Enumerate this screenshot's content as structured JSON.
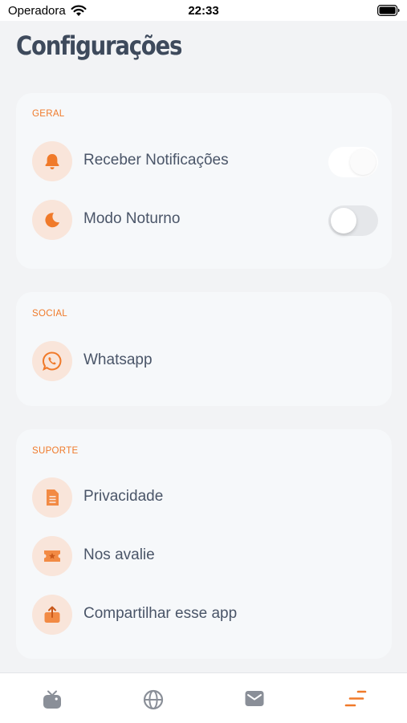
{
  "status_bar": {
    "carrier": "Operadora",
    "time": "22:33"
  },
  "title": "Configurações",
  "colors": {
    "accent": "#f07a2a",
    "icon_bg": "#f9e5da",
    "text": "#4a5568",
    "title": "#3e4a5c",
    "card": "#f6f8fa",
    "page_bg": "#f2f3f5",
    "tab_inactive": "#8a8f98"
  },
  "sections": [
    {
      "label": "GERAL",
      "items": [
        {
          "label": "Receber Notificações",
          "icon": "bell-icon",
          "toggle": true,
          "toggle_on": true
        },
        {
          "label": "Modo Noturno",
          "icon": "moon-icon",
          "toggle": true,
          "toggle_on": false
        }
      ]
    },
    {
      "label": "SOCIAL",
      "items": [
        {
          "label": "Whatsapp",
          "icon": "whatsapp-icon"
        }
      ]
    },
    {
      "label": "SUPORTE",
      "items": [
        {
          "label": "Privacidade",
          "icon": "document-icon"
        },
        {
          "label": "Nos avalie",
          "icon": "ticket-star-icon"
        },
        {
          "label": "Compartilhar esse app",
          "icon": "share-icon"
        }
      ]
    }
  ],
  "tab_bar": [
    {
      "icon": "tv-icon",
      "active": false
    },
    {
      "icon": "globe-icon",
      "active": false
    },
    {
      "icon": "mail-icon",
      "active": false
    },
    {
      "icon": "settings-lines-icon",
      "active": true
    }
  ]
}
